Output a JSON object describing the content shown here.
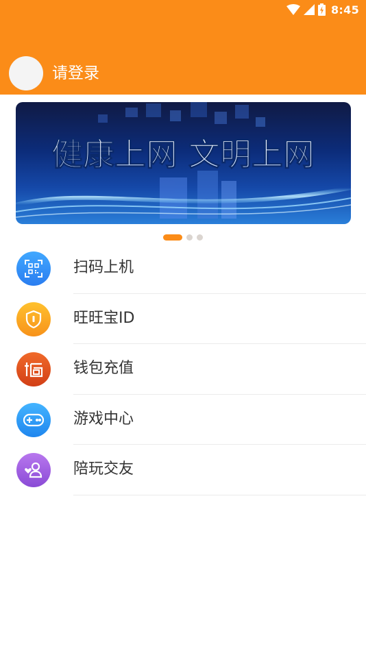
{
  "status_bar": {
    "time": "8:45",
    "wifi_icon": "wifi-icon",
    "signal_icon": "signal-icon",
    "battery_icon": "battery-charging-icon"
  },
  "header": {
    "background_color": "#fb8c18",
    "login_label": "请登录",
    "avatar_icon": "avatar"
  },
  "banner": {
    "headline": "健康上网 文明上网",
    "slide_count": 3,
    "active_slide": 1
  },
  "menu": {
    "items": [
      {
        "label": "扫码上机",
        "icon": "qr-code-icon",
        "color": "#2f8cf7"
      },
      {
        "label": "旺旺宝ID",
        "icon": "shield-icon",
        "color": "#fba51a"
      },
      {
        "label": "钱包充值",
        "icon": "wallet-icon",
        "color": "#e2501f"
      },
      {
        "label": "游戏中心",
        "icon": "gamepad-icon",
        "color": "#2d9bf5"
      },
      {
        "label": "陪玩交友",
        "icon": "friend-icon",
        "color": "#a15ee0"
      }
    ]
  }
}
